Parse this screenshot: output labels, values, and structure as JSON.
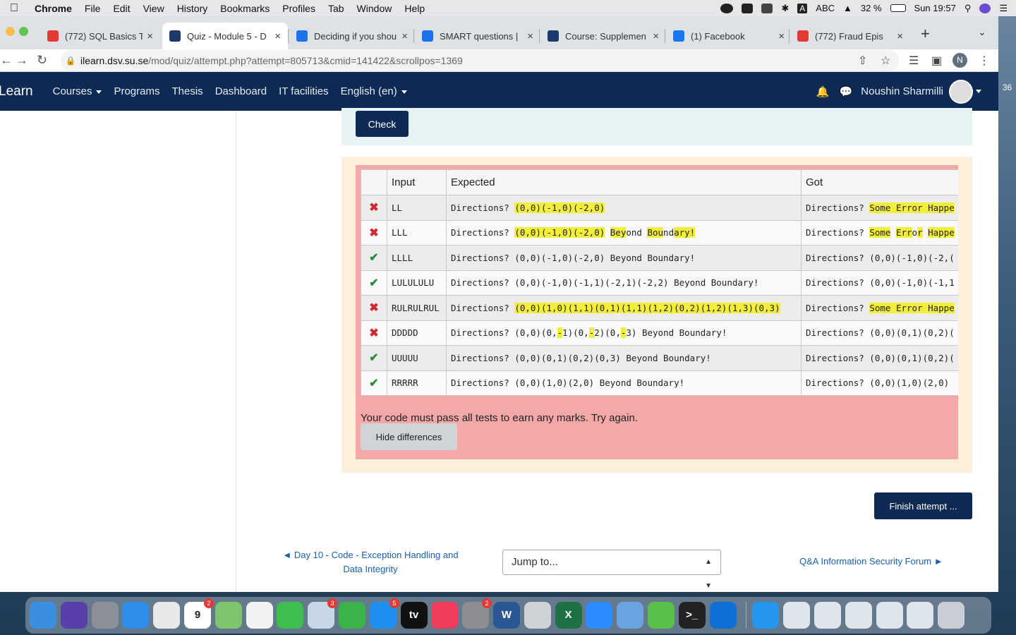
{
  "menubar": {
    "app": "Chrome",
    "items": [
      "File",
      "Edit",
      "View",
      "History",
      "Bookmarks",
      "Profiles",
      "Tab",
      "Window",
      "Help"
    ],
    "input_source": "ABC",
    "battery": "32 %",
    "clock": "Sun 19:57"
  },
  "tabs": [
    {
      "title": "(772) SQL Basics Tu",
      "color": "#e53935"
    },
    {
      "title": "Quiz - Module 5 - D",
      "color": "#1b3a6b"
    },
    {
      "title": "Deciding if you shou",
      "color": "#1a73e8"
    },
    {
      "title": "SMART questions |",
      "color": "#1a73e8"
    },
    {
      "title": "Course: Supplemen",
      "color": "#1b3a6b"
    },
    {
      "title": "(1) Facebook",
      "color": "#1877f2"
    },
    {
      "title": "(772) Fraud Epis",
      "color": "#e53935"
    }
  ],
  "url": {
    "host": "ilearn.dsv.su.se",
    "path": "/mod/quiz/attempt.php?attempt=805713&cmid=141422&scrollpos=1369"
  },
  "profile_initial": "N",
  "site": {
    "brand": "Learn",
    "nav": [
      "Courses",
      "Programs",
      "Thesis",
      "Dashboard",
      "IT facilities",
      "English (en)"
    ],
    "user": "Noushin Sharmilli",
    "side_number": "36"
  },
  "quiz": {
    "check_label": "Check",
    "headers": {
      "input": "Input",
      "expected": "Expected",
      "got": "Got"
    },
    "rows": [
      {
        "status": "fail",
        "input": "LL",
        "expected": [
          [
            "Directions? ",
            0
          ],
          [
            "(0,0)(-1,0)(-2,0)",
            1
          ]
        ],
        "got": [
          [
            "Directions? ",
            0
          ],
          [
            "Some Error Happe",
            1
          ]
        ]
      },
      {
        "status": "fail",
        "input": "LLL",
        "expected": [
          [
            "Directions? ",
            0
          ],
          [
            "(0,0)(-1,0)(-2,0)",
            1
          ],
          [
            " ",
            0
          ],
          [
            "Bey",
            1
          ],
          [
            "ond ",
            0
          ],
          [
            "Bou",
            1
          ],
          [
            "nd",
            0
          ],
          [
            "ary!",
            1
          ]
        ],
        "got": [
          [
            "Directions? ",
            0
          ],
          [
            "Some",
            1
          ],
          [
            " ",
            0
          ],
          [
            "Err",
            1
          ],
          [
            "o",
            0
          ],
          [
            "r",
            1
          ],
          [
            " ",
            0
          ],
          [
            "Happe",
            1
          ]
        ]
      },
      {
        "status": "pass",
        "input": "LLLL",
        "expected": [
          [
            "Directions? (0,0)(-1,0)(-2,0) Beyond Boundary!",
            0
          ]
        ],
        "got": [
          [
            "Directions? (0,0)(-1,0)(-2,(",
            0
          ]
        ]
      },
      {
        "status": "pass",
        "input": "LULULULU",
        "expected": [
          [
            "Directions? (0,0)(-1,0)(-1,1)(-2,1)(-2,2) Beyond Boundary!",
            0
          ]
        ],
        "got": [
          [
            "Directions? (0,0)(-1,0)(-1,1",
            0
          ]
        ]
      },
      {
        "status": "fail",
        "input": "RULRULRUL",
        "expected": [
          [
            "Directions? ",
            0
          ],
          [
            "(0,0)(1,0)(1,1)(0,1)(1,1)(1,2)(0,2)(1,2)(1,3)(0,3)",
            1
          ]
        ],
        "got": [
          [
            "Directions? ",
            0
          ],
          [
            "Some Error Happe",
            1
          ]
        ]
      },
      {
        "status": "fail",
        "input": "DDDDD",
        "expected": [
          [
            "Directions? (0,0)(0,",
            0
          ],
          [
            "-",
            1
          ],
          [
            "1)(0,",
            0
          ],
          [
            "-",
            1
          ],
          [
            "2)(0,",
            0
          ],
          [
            "-",
            1
          ],
          [
            "3) Beyond Boundary!",
            0
          ]
        ],
        "got": [
          [
            "Directions? (0,0)(0,1)(0,2)(",
            0
          ]
        ]
      },
      {
        "status": "pass",
        "input": "UUUUU",
        "expected": [
          [
            "Directions? (0,0)(0,1)(0,2)(0,3) Beyond Boundary!",
            0
          ]
        ],
        "got": [
          [
            "Directions? (0,0)(0,1)(0,2)(",
            0
          ]
        ]
      },
      {
        "status": "pass",
        "input": "RRRRR",
        "expected": [
          [
            "Directions? (0,0)(1,0)(2,0) Beyond Boundary!",
            0
          ]
        ],
        "got": [
          [
            "Directions? (0,0)(1,0)(2,0)",
            0
          ]
        ]
      }
    ],
    "message": "Your code must pass all tests to earn any marks. Try again.",
    "hide_label": "Hide differences",
    "finish_label": "Finish attempt ...",
    "prev_link": "◄ Day 10 - Code - Exception Handling and Data Integrity",
    "jump_label": "Jump to...",
    "next_link": "Q&A Information Security Forum ►"
  },
  "dock": [
    {
      "name": "finder",
      "color": "#3b8fe0"
    },
    {
      "name": "siri",
      "color": "#5b3fa8"
    },
    {
      "name": "launchpad",
      "color": "#8a8f98"
    },
    {
      "name": "safari",
      "color": "#2f8fe8"
    },
    {
      "name": "chrome",
      "color": "#e8e8e8"
    },
    {
      "name": "calendar",
      "color": "#ffffff",
      "badge": "2",
      "text": "9"
    },
    {
      "name": "maps",
      "color": "#7ec46e"
    },
    {
      "name": "photos",
      "color": "#f2f2f2"
    },
    {
      "name": "messages",
      "color": "#3cbf4e"
    },
    {
      "name": "preview",
      "color": "#c7d7e8",
      "badge": "3"
    },
    {
      "name": "facetime",
      "color": "#3cb34a"
    },
    {
      "name": "appstore",
      "color": "#1f8ff0",
      "badge": "5"
    },
    {
      "name": "tv",
      "color": "#111111",
      "text": "tv"
    },
    {
      "name": "music",
      "color": "#f23c5c"
    },
    {
      "name": "settings",
      "color": "#8d8d93",
      "badge": "2"
    },
    {
      "name": "word",
      "color": "#2b5797",
      "text": "W"
    },
    {
      "name": "pen",
      "color": "#cfd3d8"
    },
    {
      "name": "excel",
      "color": "#1e7145",
      "text": "X"
    },
    {
      "name": "zoom",
      "color": "#2d8cff"
    },
    {
      "name": "network",
      "color": "#6aa3e0"
    },
    {
      "name": "editor",
      "color": "#59c14a"
    },
    {
      "name": "terminal",
      "color": "#222222",
      "text": ">_"
    },
    {
      "name": "teamviewer",
      "color": "#0e6fd6"
    },
    {
      "name": "docker",
      "color": "#2496ed"
    },
    {
      "name": "screens1",
      "color": "#dfe5ec"
    },
    {
      "name": "screens2",
      "color": "#dfe5ec"
    },
    {
      "name": "screens3",
      "color": "#dfe5ec"
    },
    {
      "name": "screens4",
      "color": "#dfe5ec"
    },
    {
      "name": "screens5",
      "color": "#dfe5ec"
    },
    {
      "name": "trash",
      "color": "#c9ced6"
    }
  ]
}
